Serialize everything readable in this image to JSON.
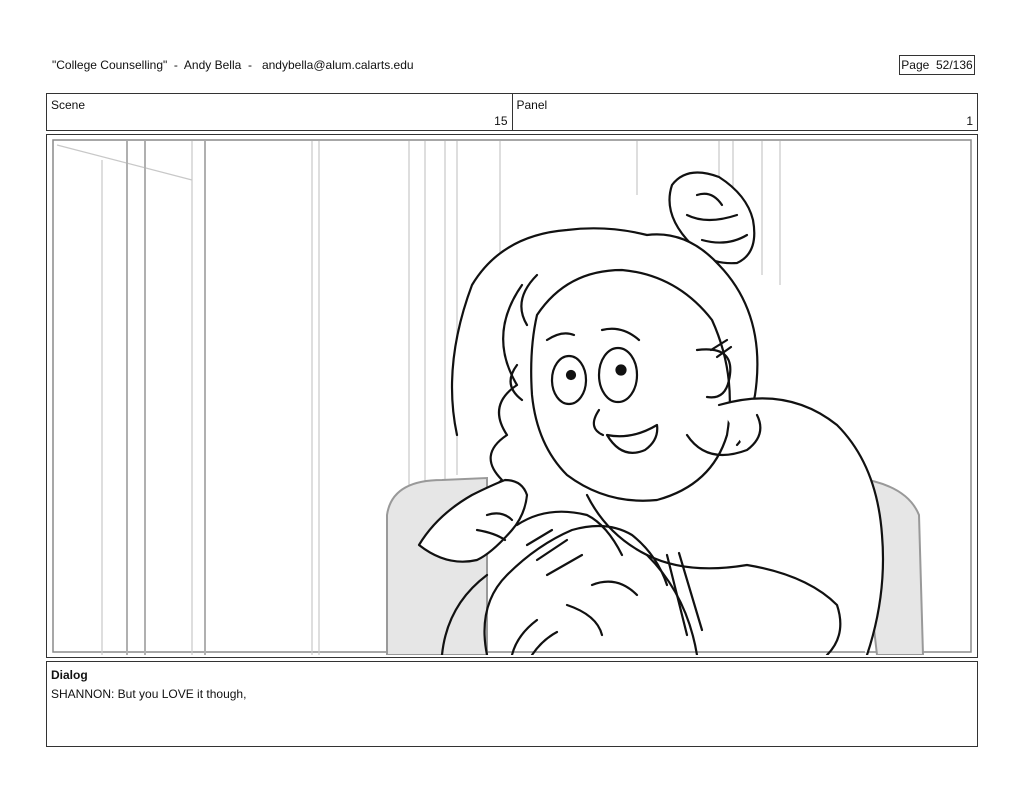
{
  "header": {
    "title": "\"College Counselling\"  -  Andy Bella  -   andybella@alum.calarts.edu",
    "page": "Page  52/136"
  },
  "info": {
    "scene_label": "Scene",
    "scene_value": "15",
    "panel_label": "Panel",
    "panel_value": "1"
  },
  "dialog": {
    "heading": "Dialog",
    "text": "SHANNON: But you LOVE it though,"
  },
  "colors": {
    "border": "#333333",
    "sketch_line": "#111111",
    "background_line": "#c8c8c8",
    "chair_fill": "#e6e6e6"
  }
}
